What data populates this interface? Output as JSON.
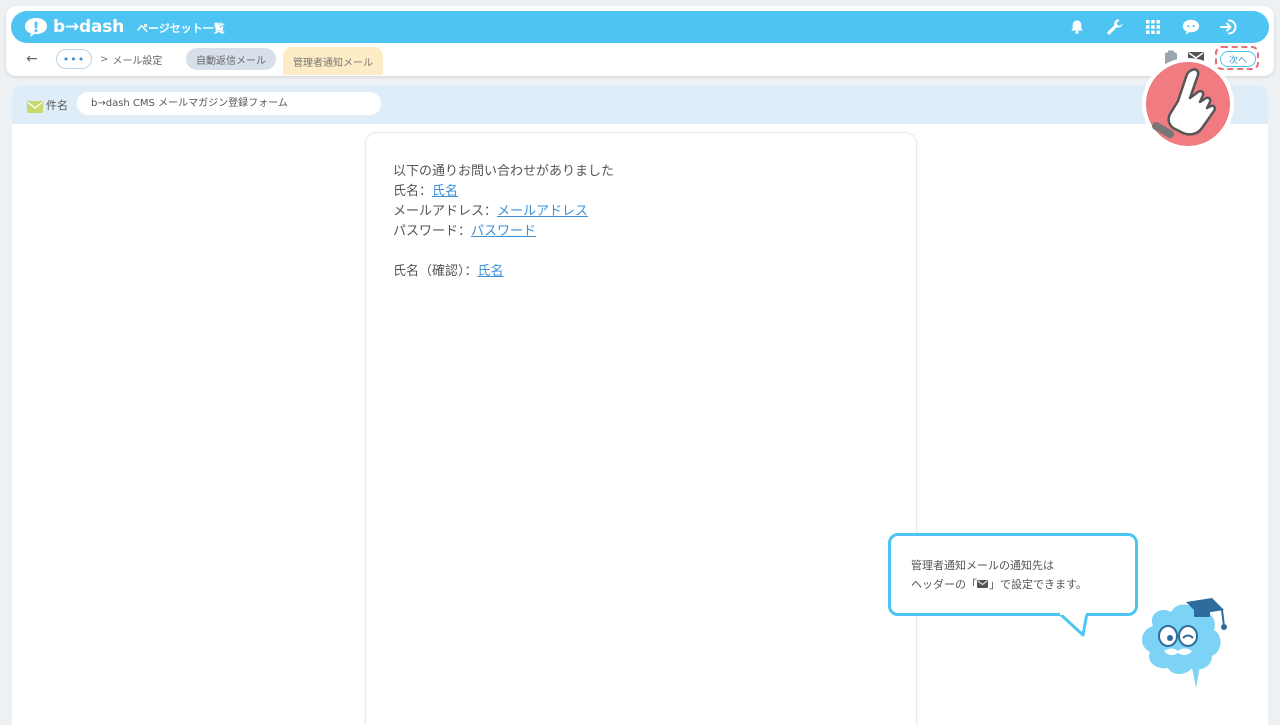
{
  "app": {
    "brand": "b→dash",
    "page_title": "ページセット一覧"
  },
  "header_icons": [
    "bell-icon",
    "wrench-icon",
    "grid-icon",
    "support-icon",
    "logout-icon"
  ],
  "breadcrumb": {
    "back_icon": "arrow-left-icon",
    "dots_label": "•••",
    "separator": ">",
    "current": "メール設定",
    "tabs": [
      {
        "label": "自動返信メール",
        "active": false
      },
      {
        "label": "管理者通知メール",
        "active": true
      }
    ]
  },
  "toolbar": {
    "next_label": "次へ",
    "tools": [
      "clipboard-icon",
      "mail-icon"
    ]
  },
  "subject": {
    "label": "件名",
    "value": "b→dash CMS メールマガジン登録フォーム"
  },
  "mail": {
    "intro": "以下の通りお問い合わせがありました",
    "lines": [
      {
        "label": "氏名：",
        "link": "氏名"
      },
      {
        "label": "メールアドレス：",
        "link": "メールアドレス"
      },
      {
        "label": "パスワード：",
        "link": "パスワード"
      }
    ],
    "confirm": {
      "label": "氏名（確認）：",
      "link": "氏名"
    }
  },
  "tooltip": {
    "line1": "管理者通知メールの通知先は",
    "line2_before": "ヘッダーの「",
    "line2_after": "」で設定できます。"
  },
  "colors": {
    "accent": "#4ec4f3",
    "highlight": "#e8707a",
    "active_tab": "#fdecc6",
    "inactive_tab": "#d7e0ea"
  }
}
